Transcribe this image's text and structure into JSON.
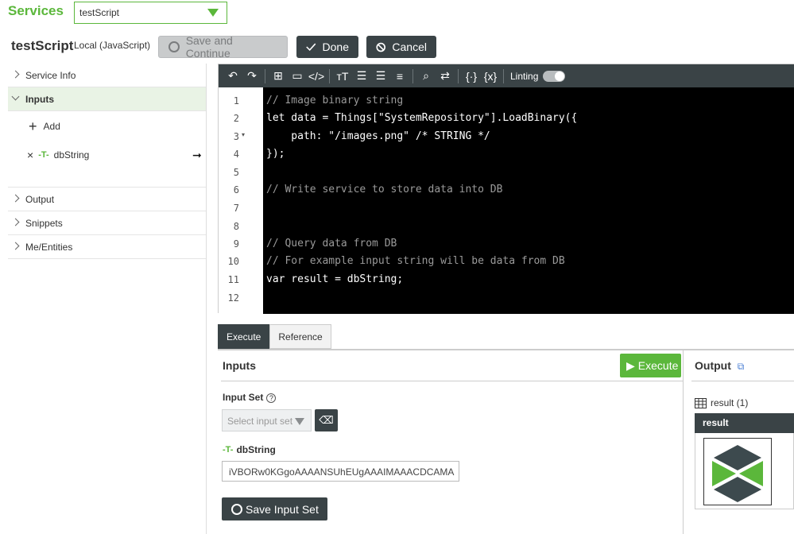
{
  "services": {
    "label": "Services",
    "selected": "testScript"
  },
  "header": {
    "title": "testScript",
    "subtitle": "Local (JavaScript)",
    "save_label": "Save and Continue",
    "done_label": "Done",
    "cancel_label": "Cancel"
  },
  "sidebar": {
    "items": [
      {
        "label": "Service Info"
      },
      {
        "label": "Inputs"
      },
      {
        "label": "Output"
      },
      {
        "label": "Snippets"
      },
      {
        "label": "Me/Entities"
      }
    ],
    "add_label": "Add",
    "param_name": "dbString"
  },
  "editor": {
    "linting_label": "Linting",
    "line_numbers": [
      "1",
      "2",
      "3",
      "4",
      "5",
      "6",
      "7",
      "8",
      "9",
      "10",
      "11",
      "12"
    ],
    "lines": [
      "// Image binary string",
      "let data = Things[\"SystemRepository\"].LoadBinary({",
      "    path: \"/images.png\" /* STRING */",
      "});",
      "",
      "// Write service to store data into DB",
      "",
      "",
      "// Query data from DB",
      "// For example input string will be data from DB",
      "var result = dbString;",
      ""
    ]
  },
  "tabs": [
    {
      "label": "Execute"
    },
    {
      "label": "Reference"
    }
  ],
  "execute": {
    "inputs_title": "Inputs",
    "execute_label": "Execute",
    "input_set_label": "Input Set",
    "input_set_placeholder": "Select input set",
    "param_label": "dbString",
    "param_value": "iVBORw0KGgoAAAANSUhEUgAAAIMAAACDCAMA",
    "save_input_set_label": "Save Input Set"
  },
  "output": {
    "title": "Output",
    "result_label": "result (1)",
    "column": "result"
  },
  "colors": {
    "accent": "#5bb73b",
    "dark": "#3a4346"
  }
}
